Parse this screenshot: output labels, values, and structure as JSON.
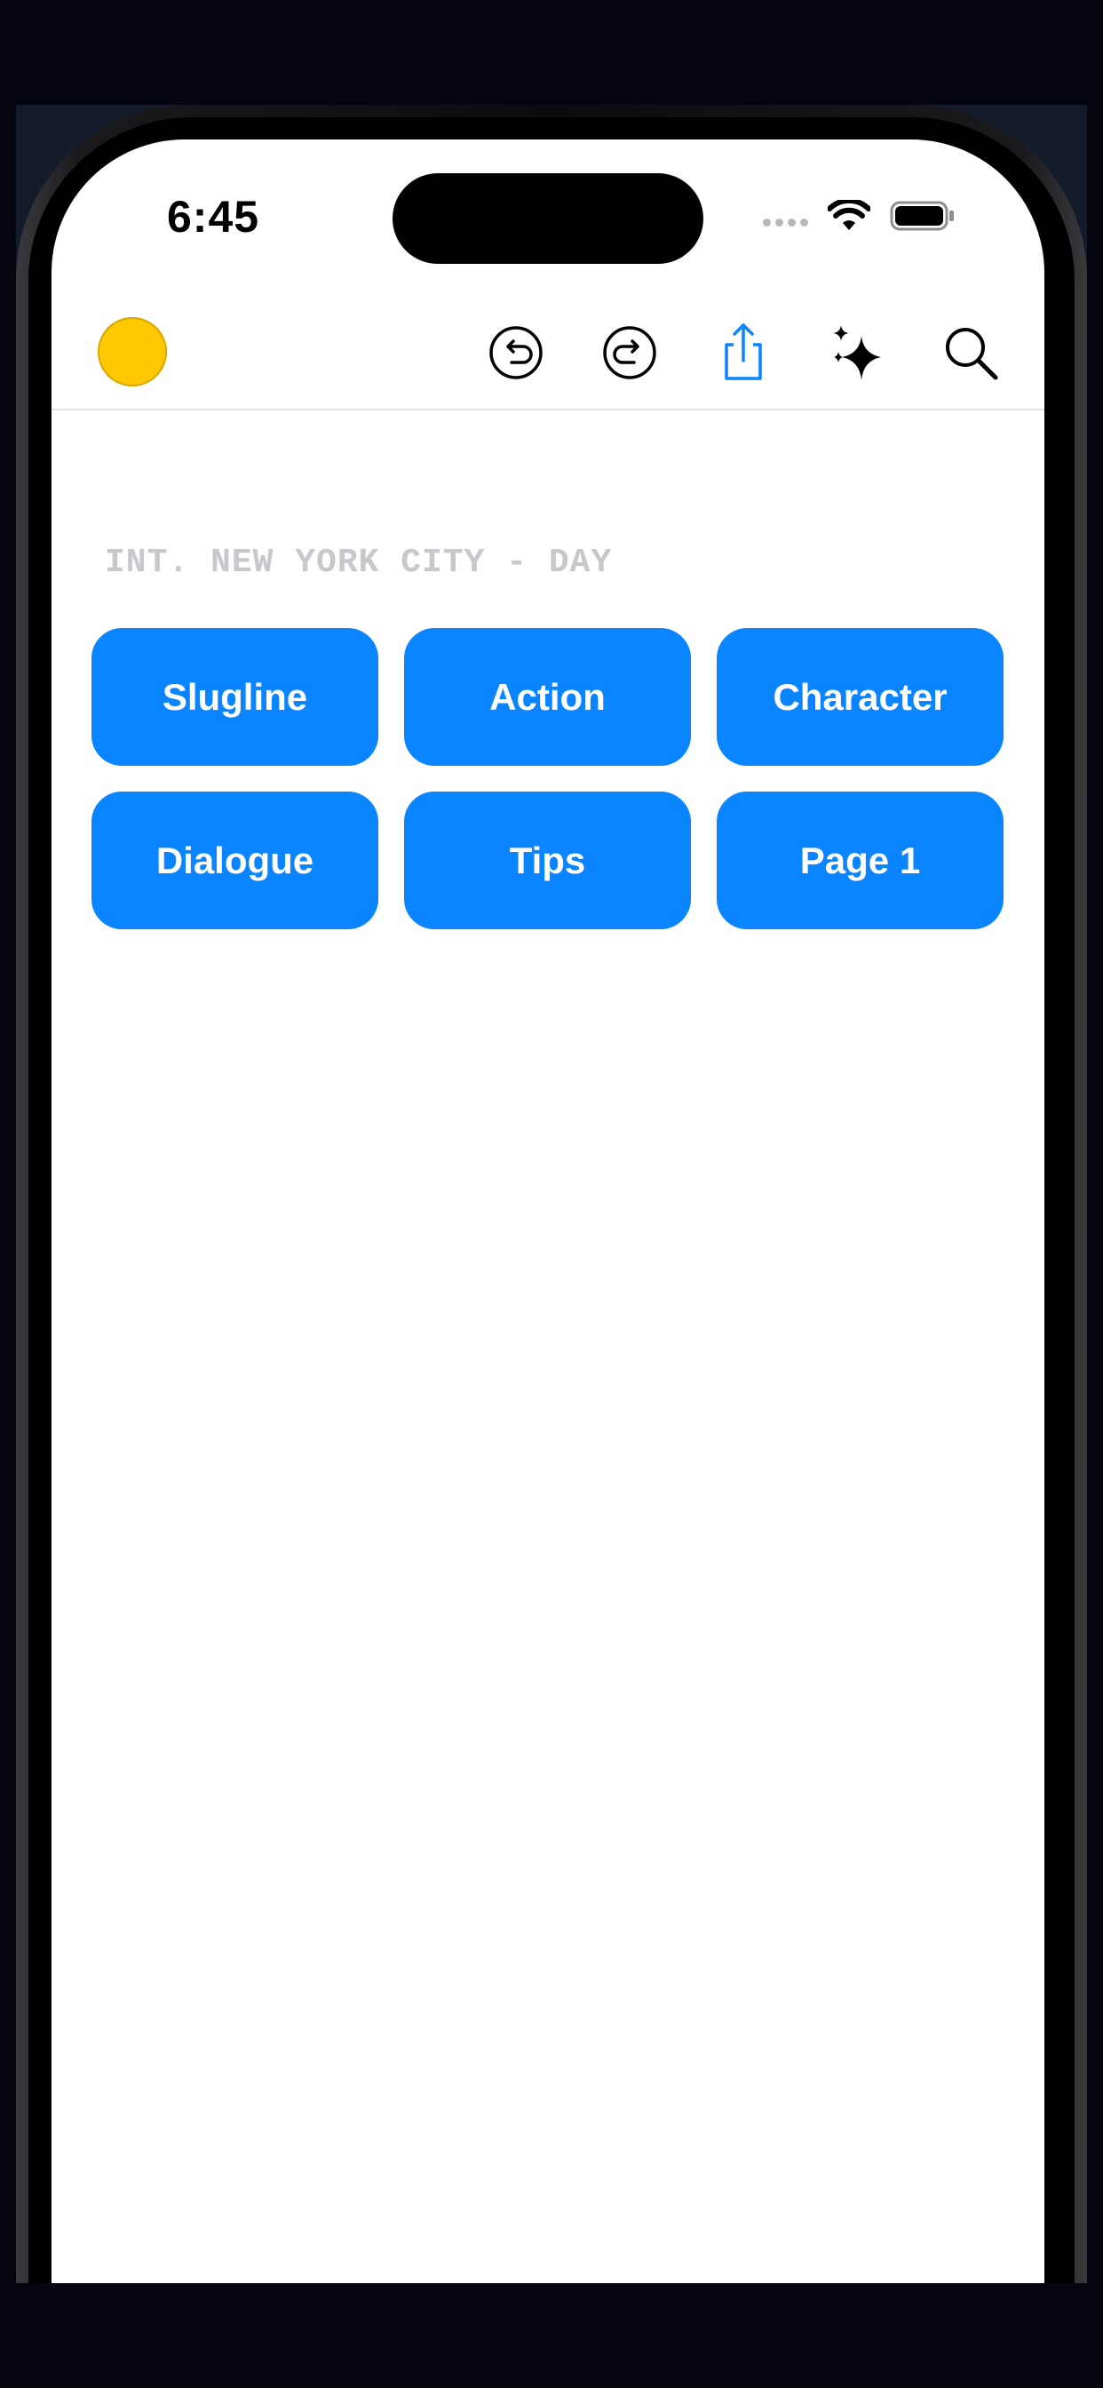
{
  "status_bar": {
    "time": "6:45"
  },
  "toolbar": {
    "icons": [
      "undo-icon",
      "redo-icon",
      "share-icon",
      "sparkles-icon",
      "search-icon"
    ],
    "accent_color": "#0a84ff",
    "avatar_color": "#ffc800"
  },
  "editor": {
    "placeholder_line": "INT. NEW YORK CITY - DAY"
  },
  "buttons": {
    "slugline": "Slugline",
    "action": "Action",
    "character": "Character",
    "dialogue": "Dialogue",
    "tips": "Tips",
    "page": "Page 1"
  }
}
